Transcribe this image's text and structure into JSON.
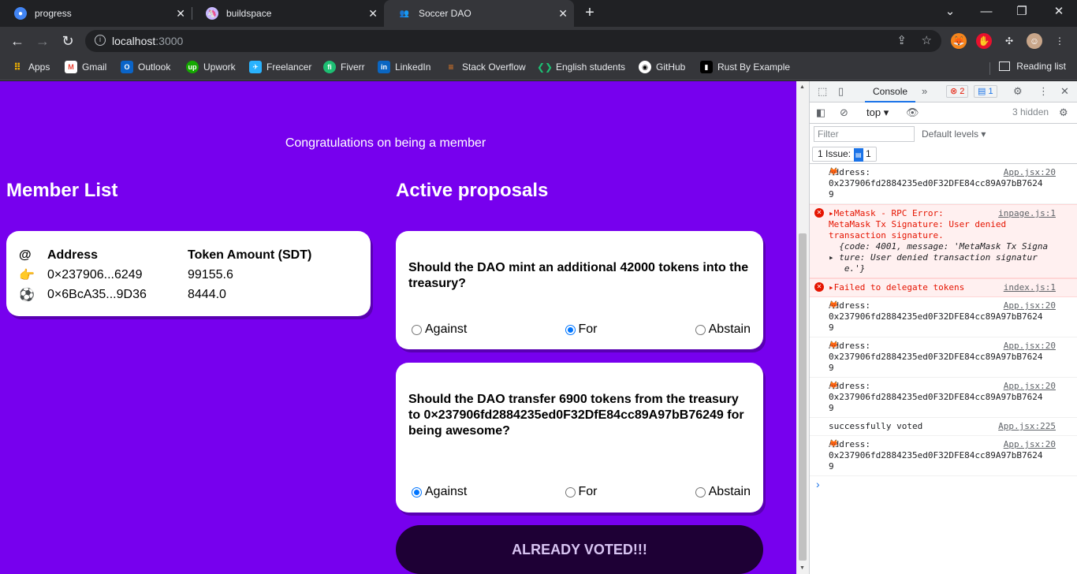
{
  "browser": {
    "tabs": [
      {
        "title": "progress",
        "active": false
      },
      {
        "title": "buildspace",
        "active": false
      },
      {
        "title": "Soccer DAO",
        "active": true
      }
    ],
    "url_host": "localhost",
    "url_port": ":3000",
    "bookmarks": [
      "Apps",
      "Gmail",
      "Outlook",
      "Upwork",
      "Freelancer",
      "Fiverr",
      "LinkedIn",
      "Stack Overflow",
      "English students",
      "GitHub",
      "Rust By Example"
    ],
    "reading_list": "Reading list"
  },
  "page": {
    "congrats": "Congratulations on being a member",
    "member_heading": "Member List",
    "proposals_heading": "Active proposals",
    "member_table": {
      "headers": {
        "icon": "@",
        "address": "Address",
        "amount": "Token Amount (SDT)"
      },
      "rows": [
        {
          "icon": "👉",
          "address": "0×237906...6249",
          "amount": "99155.6"
        },
        {
          "icon": "⚽",
          "address": "0×6BcA35...9D36",
          "amount": "8444.0"
        }
      ]
    },
    "proposals": [
      {
        "question": "Should the DAO mint an additional 42000 tokens into the treasury?",
        "options": [
          "Against",
          "For",
          "Abstain"
        ],
        "selected": "For"
      },
      {
        "question": "Should the DAO transfer 6900 tokens from the treasury to 0×237906fd2884235ed0F32DfE84cc89A97bB76249 for being awesome?",
        "options": [
          "Against",
          "For",
          "Abstain"
        ],
        "selected": "Against"
      }
    ],
    "voted_button": "ALREADY VOTED!!!"
  },
  "devtools": {
    "tab": "Console",
    "errors_count": "2",
    "issues_count": "1",
    "context": "top",
    "hidden": "3 hidden",
    "filter_placeholder": "Filter",
    "levels": "Default levels",
    "issue_label": "1 Issue:",
    "issue_count": "1",
    "messages": [
      {
        "text": "Address:\n0x237906fd2884235ed0F32DFE84cc89A97bB7624\n9",
        "src": "App.jsx:20"
      },
      {
        "text": "▸MetaMask - RPC Error:\nMetaMask Tx Signature: User denied\ntransaction signature.",
        "obj": "  {code: 4001, message: 'MetaMask Tx Signa\n▸ ture: User denied transaction signatur\n   e.'}",
        "src": "inpage.js:1"
      },
      {
        "text": "▸Failed to delegate tokens",
        "src": "index.js:1"
      },
      {
        "text": "Address:\n0x237906fd2884235ed0F32DFE84cc89A97bB7624\n9",
        "src": "App.jsx:20"
      },
      {
        "text": "Address:\n0x237906fd2884235ed0F32DFE84cc89A97bB7624\n9",
        "src": "App.jsx:20"
      },
      {
        "text": "Address:\n0x237906fd2884235ed0F32DFE84cc89A97bB7624\n9",
        "src": "App.jsx:20"
      },
      {
        "text": "successfully voted",
        "src": "App.jsx:225"
      },
      {
        "text": "Address:\n0x237906fd2884235ed0F32DFE84cc89A97bB7624\n9",
        "src": "App.jsx:20"
      }
    ]
  }
}
